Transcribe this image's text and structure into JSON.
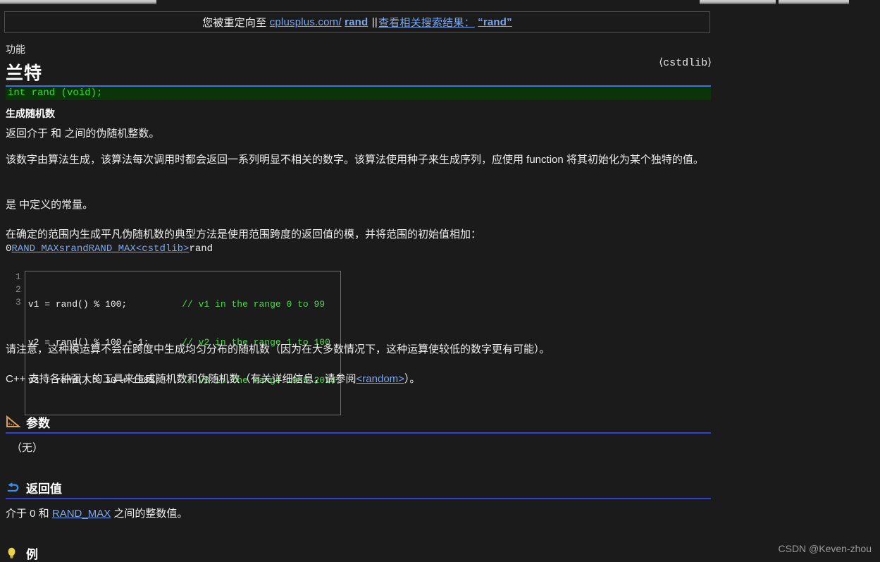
{
  "banner": {
    "prefix": "您被重定向至",
    "domain": "cplusplus.com/",
    "term": "rand",
    "separator": "||",
    "search_label": "查看相关搜索结果：",
    "search_term": "“rand”"
  },
  "header": {
    "kicker": "功能",
    "title": "兰特",
    "include": "⟨cstdlib⟩",
    "signature": "int rand (void);",
    "subhead": "生成随机数"
  },
  "body": {
    "p1": "返回介于 和 之间的伪随机整数。",
    "p2": "该数字由算法生成，该算法每次调用时都会返回一系列明显不相关的数字。该算法使用种子来生成序列，应使用 function 将其初始化为某个独特的值。",
    "p3": "是 中定义的常量。",
    "p4": "在确定的范围内生成平凡伪随机数的典型方法是使用范围跨度的返回值的模，并将范围的初始值相加：",
    "mono_line": {
      "zero": "0",
      "link1": "RAND_MAXsrandRAND_MAX",
      "link2": "<cstdlib>",
      "tail": "rand"
    },
    "p6": "请注意，这种模运算不会在跨度中生成均匀分布的随机数（因为在大多数情况下，这种运算使较低的数字更有可能）。",
    "p7_a": "C++ 支持各种强大的工具来生成随机数和伪随机数（有关详细信息，请参阅",
    "p7_link": "<random>",
    "p7_b": "）。"
  },
  "code_block": {
    "line_numbers": [
      "1",
      "2",
      "3"
    ],
    "lines": [
      {
        "code": "v1 = rand() % 100;          ",
        "comment": "// v1 in the range 0 to 99"
      },
      {
        "code": "v2 = rand() % 100 + 1;      ",
        "comment": "// v2 in the range 1 to 100"
      },
      {
        "code": "v3 = rand() % 30 + 1985;    ",
        "comment": "// v3 in the range 1985-2014"
      }
    ]
  },
  "sections": {
    "parameters": {
      "icon": "ruler-icon",
      "label": "参数",
      "body": "（无）"
    },
    "return_value": {
      "icon": "return-arrow-icon",
      "label": "返回值",
      "body_a": "介于 0 和 ",
      "body_link": "RAND_MAX",
      "body_b": " 之间的整数值。"
    },
    "example": {
      "icon": "lightbulb-icon",
      "label": "例"
    }
  },
  "watermark": "CSDN @Keven-zhou",
  "colors": {
    "background": "#1b1b1b",
    "link": "#7aa7ef",
    "rule": "#2f3fe0",
    "title_rule": "#3f6fd8",
    "signature_bg": "#0b3508",
    "signature_fg": "#2ee02e",
    "comment": "#4fd94f"
  }
}
